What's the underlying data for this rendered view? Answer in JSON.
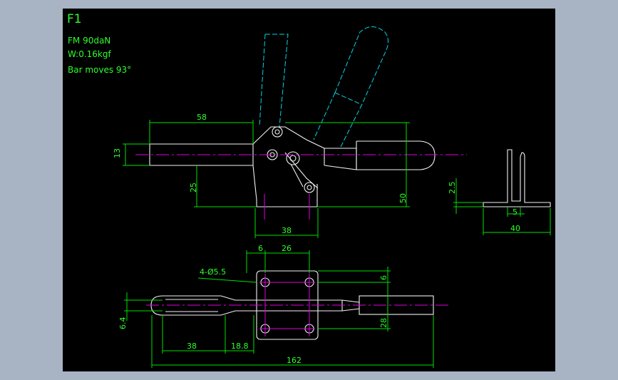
{
  "title": "F1",
  "notes": {
    "force": "FM 90daN",
    "weight": "W:0.16kgf",
    "bar": "Bar moves 93°"
  },
  "dimensions": {
    "d58": "58",
    "d13": "13",
    "d25": "25",
    "d50": "50",
    "d38_side": "38",
    "d2_5": "2.5",
    "d5": "5",
    "d40": "40",
    "d6_top": "6",
    "d26": "26",
    "d6_right": "6",
    "holes": "4-Ø5.5",
    "d6_4": "6.4",
    "d28": "28",
    "d38_bottom": "38",
    "d18_8": "18.8",
    "d162": "162"
  },
  "colors": {
    "background": "#000000",
    "outline": "#f2f2f2",
    "dimension": "#00e000",
    "text": "#2cff2c",
    "phantom": "#00d6e8",
    "centerline": "#e000e0",
    "window": "#a8b4c4"
  }
}
